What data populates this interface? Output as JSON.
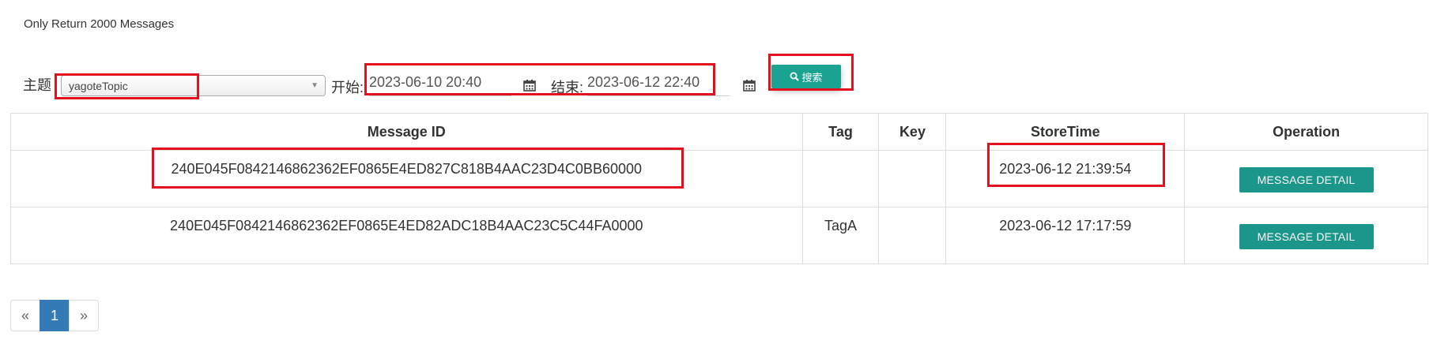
{
  "notice": "Only Return 2000 Messages",
  "filters": {
    "topic_label": "主题",
    "topic_value": "yagoteTopic",
    "start_label": "开始:",
    "start_value": "2023-06-10 20:40",
    "end_label": "结束:",
    "end_value": "2023-06-12 22:40",
    "search_label": "搜索",
    "search_icon": "magnifier-icon",
    "calendar_icon": "calendar-icon"
  },
  "table": {
    "headers": [
      "Message ID",
      "Tag",
      "Key",
      "StoreTime",
      "Operation"
    ],
    "rows": [
      {
        "message_id": "240E045F0842146862362EF0865E4ED827C818B4AAC23D4C0BB60000",
        "tag": "",
        "key": "",
        "store_time": "2023-06-12 21:39:54",
        "action": "MESSAGE DETAIL"
      },
      {
        "message_id": "240E045F0842146862362EF0865E4ED82ADC18B4AAC23C5C44FA0000",
        "tag": "TagA",
        "key": "",
        "store_time": "2023-06-12 17:17:59",
        "action": "MESSAGE DETAIL"
      }
    ]
  },
  "pagination": {
    "prev": "«",
    "current": "1",
    "next": "»"
  },
  "colors": {
    "accent": "#1aa391",
    "highlight": "#e3101d",
    "page_active": "#337ab7"
  }
}
